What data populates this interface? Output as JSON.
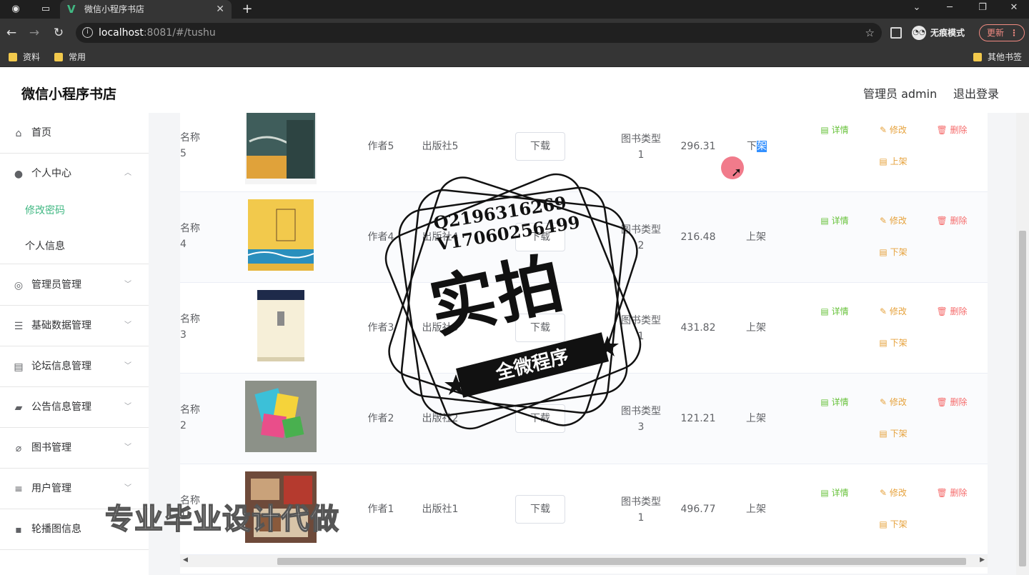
{
  "browser": {
    "tab_title": "微信小程序书店",
    "url_host": "localhost",
    "url_path": ":8081/#/tushu",
    "incognito_label": "无痕模式",
    "update_label": "更新",
    "bookmarks": [
      "资料",
      "常用"
    ],
    "other_bookmarks": "其他书签"
  },
  "header": {
    "title": "微信小程序书店",
    "user": "管理员 admin",
    "logout": "退出登录"
  },
  "sidebar": {
    "items": [
      {
        "label": "首页",
        "icon": "home-icon"
      },
      {
        "label": "个人中心",
        "icon": "user-icon"
      },
      {
        "label": "管理员管理",
        "icon": "admin-icon"
      },
      {
        "label": "基础数据管理",
        "icon": "sliders-icon"
      },
      {
        "label": "论坛信息管理",
        "icon": "document-icon"
      },
      {
        "label": "公告信息管理",
        "icon": "notice-icon"
      },
      {
        "label": "图书管理",
        "icon": "book-icon"
      },
      {
        "label": "用户管理",
        "icon": "menu-icon"
      },
      {
        "label": "轮播图信息",
        "icon": "chat-icon"
      }
    ],
    "sub_items": [
      {
        "label": "修改密码",
        "active": true
      },
      {
        "label": "个人信息",
        "active": false
      }
    ]
  },
  "table": {
    "download_label": "下载",
    "detail_label": "详情",
    "edit_label": "修改",
    "delete_label": "删除",
    "rows": [
      {
        "name1": "名称",
        "name2": "5",
        "author": "作者5",
        "publisher": "出版社5",
        "type1": "图书类型",
        "type2": "1",
        "price": "296.31",
        "status_a": "下",
        "status_b": "架",
        "action": "上架"
      },
      {
        "name1": "名称",
        "name2": "4",
        "author": "作者4",
        "publisher": "出版社4",
        "type1": "图书类型",
        "type2": "2",
        "price": "216.48",
        "status": "上架",
        "action": "下架"
      },
      {
        "name1": "名称",
        "name2": "3",
        "author": "作者3",
        "publisher": "出版社3",
        "type1": "图书类型",
        "type2": "1",
        "price": "431.82",
        "status": "上架",
        "action": "下架"
      },
      {
        "name1": "名称",
        "name2": "2",
        "author": "作者2",
        "publisher": "出版社2",
        "type1": "图书类型",
        "type2": "3",
        "price": "121.21",
        "status": "上架",
        "action": "下架"
      },
      {
        "name1": "名称",
        "name2": "1",
        "author": "作者1",
        "publisher": "出版社1",
        "type1": "图书类型",
        "type2": "1",
        "price": "496.77",
        "status": "上架",
        "action": "下架"
      }
    ]
  },
  "watermark": {
    "qq": "Q2196316269",
    "vx": "V17060256499",
    "big": "实拍",
    "ribbon": "全微程序",
    "bottom": "专业毕业设计代做"
  }
}
